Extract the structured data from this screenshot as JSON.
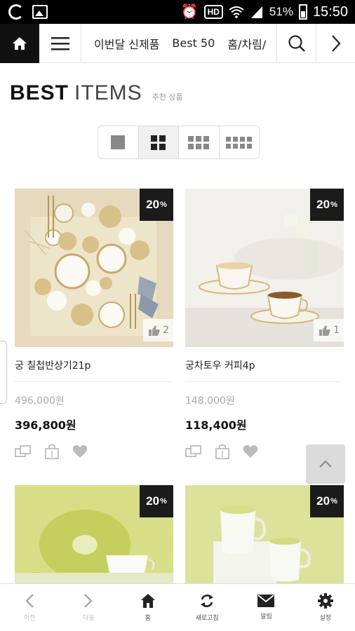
{
  "status_bar": {
    "battery": "51%",
    "time": "15:50",
    "hd_label": "HD"
  },
  "top_nav": {
    "tabs": [
      "이번달 신제품",
      "Best 50",
      "홈/차림/"
    ]
  },
  "heading": {
    "title_bold": "BEST",
    "title_light": "ITEMS",
    "subtitle": "추천 상품"
  },
  "products": [
    {
      "name": "궁 칠첩반상기21p",
      "discount": "20",
      "discount_unit": "%",
      "likes": "2",
      "original_price": "496,000원",
      "sale_price": "396,800원"
    },
    {
      "name": "궁차토우 커피4p",
      "discount": "20",
      "discount_unit": "%",
      "likes": "1",
      "original_price": "148,000원",
      "sale_price": "118,400원"
    },
    {
      "name": "",
      "discount": "20",
      "discount_unit": "%"
    },
    {
      "name": "",
      "discount": "20",
      "discount_unit": "%"
    }
  ],
  "bottom_nav": {
    "items": [
      "이전",
      "다음",
      "홈",
      "새로고침",
      "알림",
      "설정"
    ]
  },
  "colors": {
    "badge_bg": "#1b1b1b",
    "nav_home_bg": "#111111",
    "accent_green": "#d8df87"
  }
}
